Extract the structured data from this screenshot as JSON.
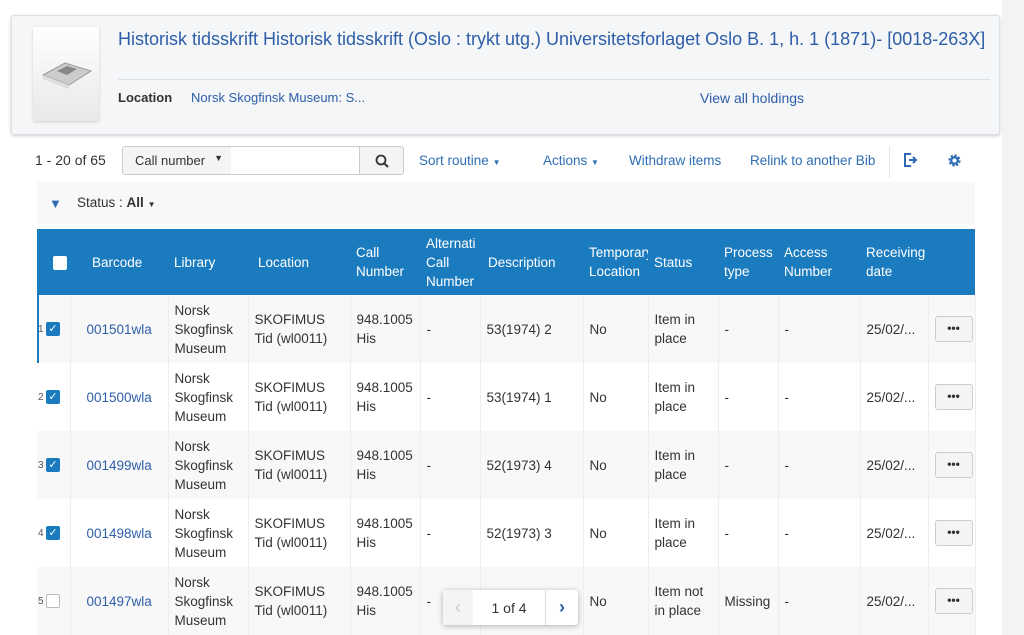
{
  "header": {
    "title": "Historisk tidsskrift Historisk tidsskrift (Oslo : trykt utg.) Universitetsforlaget Oslo B. 1, h. 1 (1871)- [0018-263X]",
    "location_label": "Location",
    "location_value": "Norsk Skogfinsk Museum: S...",
    "view_all": "View all holdings",
    "thumbnail_icon": "newspaper-icon"
  },
  "toolbar": {
    "count": "1 - 20 of 65",
    "search_field": "Call number",
    "search_value": "",
    "sort": "Sort routine",
    "actions": "Actions",
    "withdraw": "Withdraw items",
    "relink": "Relink to another Bib"
  },
  "filter": {
    "label": "Status : ",
    "value": "All"
  },
  "columns": [
    "Barcode",
    "Library",
    "Location",
    "Call Number",
    "Alternati Call Number",
    "Description",
    "Temporary Location",
    "Status",
    "Process type",
    "Access Number",
    "Receiving date"
  ],
  "rows": [
    {
      "n": "1",
      "checked": true,
      "barcode": "001501wla",
      "library": "Norsk Skogfinsk Museum",
      "location": "SKOFIMUS Tid (wl0011)",
      "call": "948.1005 His",
      "alt": "-",
      "desc": "53(1974) 2",
      "temp": "No",
      "status": "Item in place",
      "process": "-",
      "access": "-",
      "date": "25/02/..."
    },
    {
      "n": "2",
      "checked": true,
      "barcode": "001500wla",
      "library": "Norsk Skogfinsk Museum",
      "location": "SKOFIMUS Tid (wl0011)",
      "call": "948.1005 His",
      "alt": "-",
      "desc": "53(1974) 1",
      "temp": "No",
      "status": "Item in place",
      "process": "-",
      "access": "-",
      "date": "25/02/..."
    },
    {
      "n": "3",
      "checked": true,
      "barcode": "001499wla",
      "library": "Norsk Skogfinsk Museum",
      "location": "SKOFIMUS Tid (wl0011)",
      "call": "948.1005 His",
      "alt": "-",
      "desc": "52(1973) 4",
      "temp": "No",
      "status": "Item in place",
      "process": "-",
      "access": "-",
      "date": "25/02/..."
    },
    {
      "n": "4",
      "checked": true,
      "barcode": "001498wla",
      "library": "Norsk Skogfinsk Museum",
      "location": "SKOFIMUS Tid (wl0011)",
      "call": "948.1005 His",
      "alt": "-",
      "desc": "52(1973) 3",
      "temp": "No",
      "status": "Item in place",
      "process": "-",
      "access": "-",
      "date": "25/02/..."
    },
    {
      "n": "5",
      "checked": false,
      "barcode": "001497wla",
      "library": "Norsk Skogfinsk Museum",
      "location": "SKOFIMUS Tid (wl0011)",
      "call": "948.1005 His",
      "alt": "-",
      "desc": "",
      "temp": "No",
      "status": "Item not in place",
      "process": "Missing",
      "access": "-",
      "date": "25/02/..."
    }
  ],
  "row_menu": "•••",
  "pager": {
    "text": "1 of 4",
    "prev": "‹",
    "next": "›"
  },
  "colors": {
    "accent": "#1a7bbf",
    "link": "#2e5ea8"
  }
}
